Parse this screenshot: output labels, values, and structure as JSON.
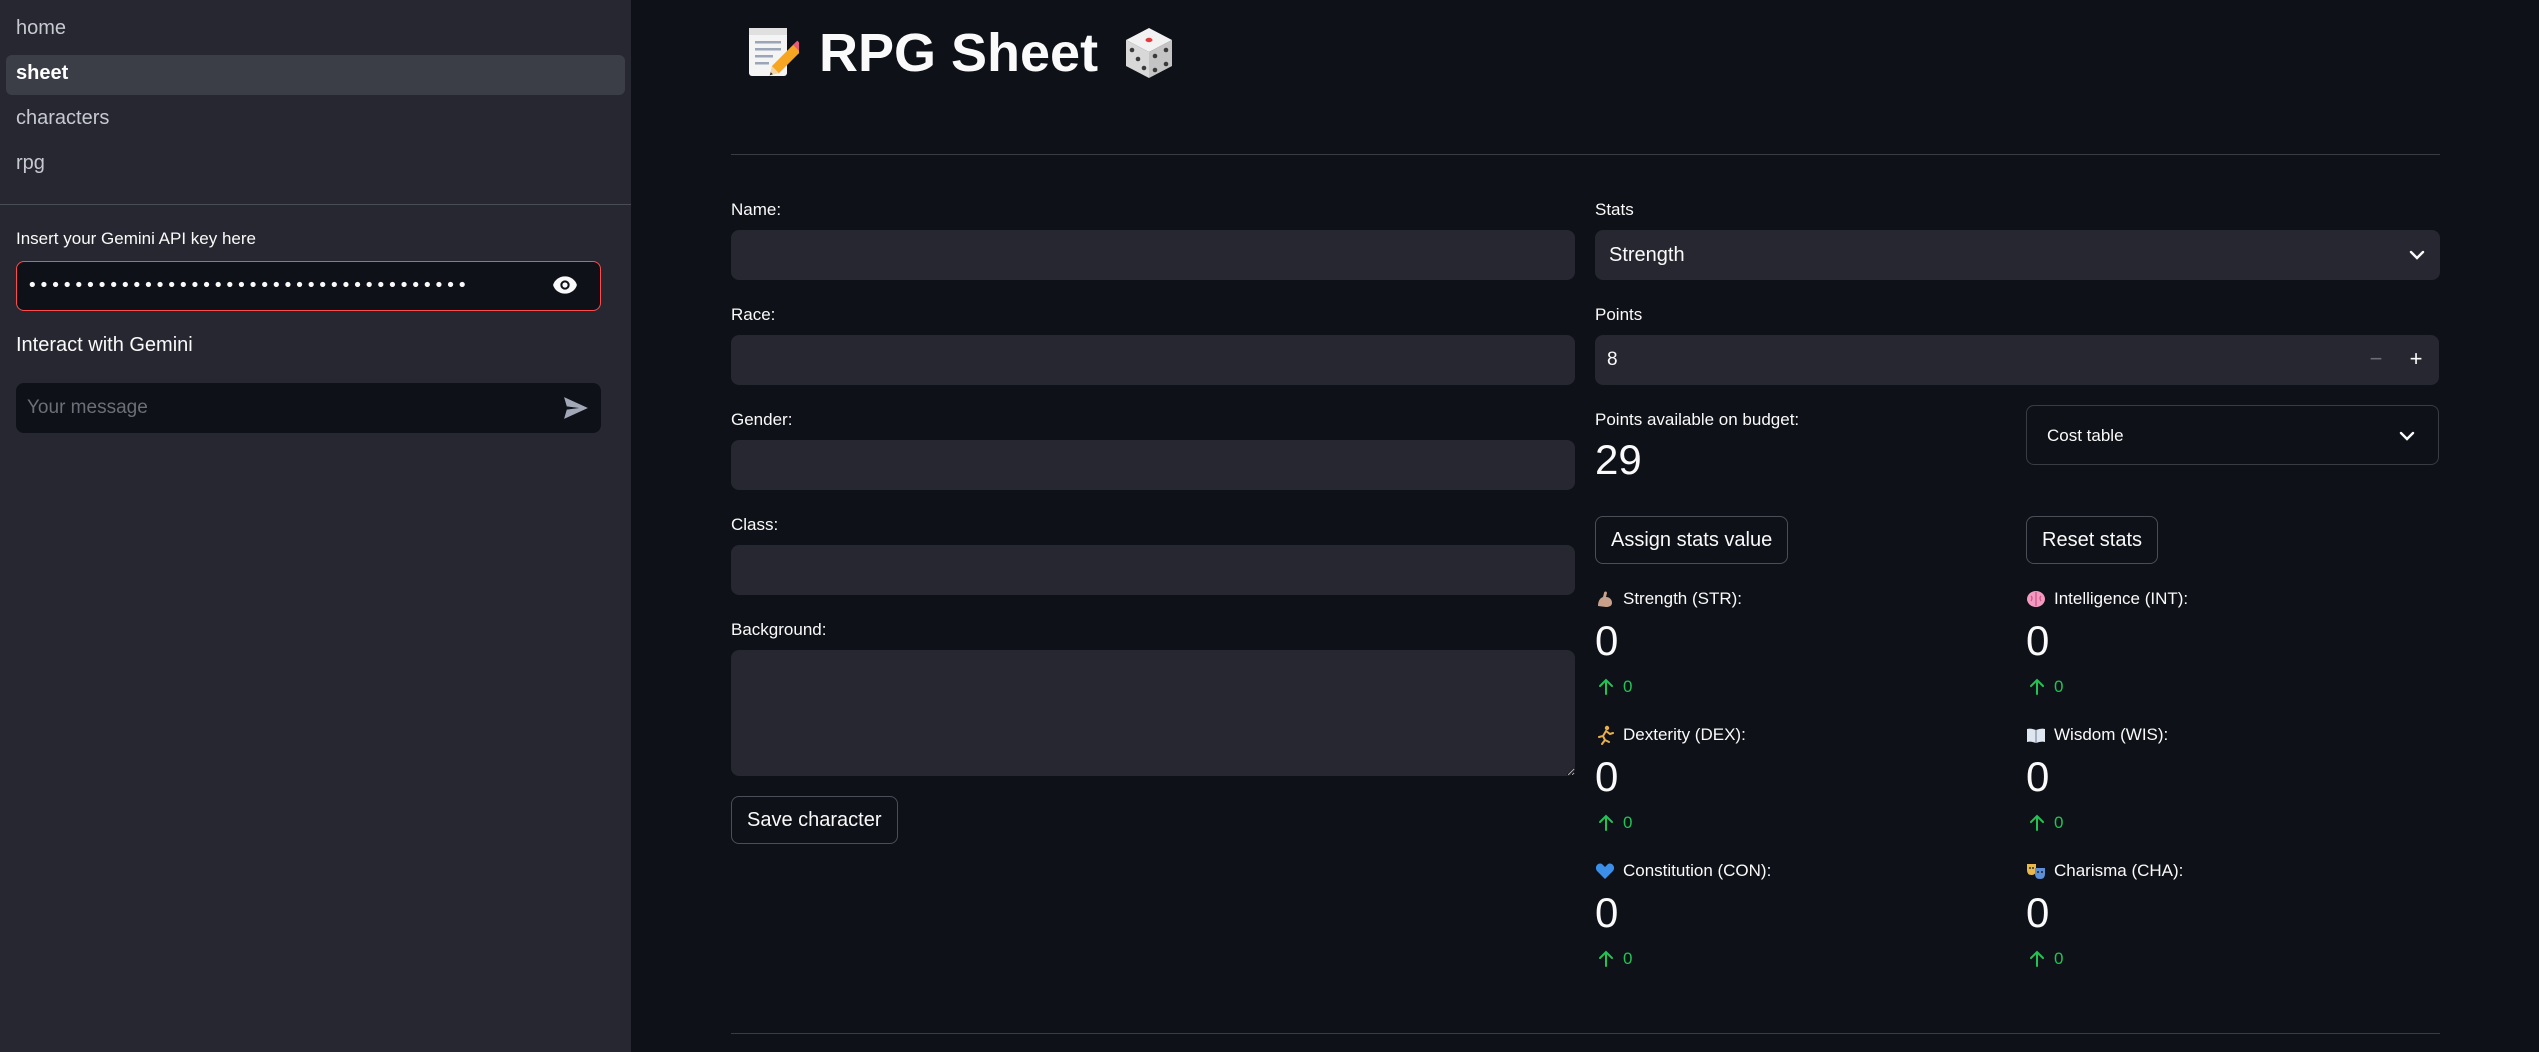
{
  "sidebar": {
    "nav": [
      {
        "label": "home",
        "active": false
      },
      {
        "label": "sheet",
        "active": true
      },
      {
        "label": "characters",
        "active": false
      },
      {
        "label": "rpg",
        "active": false
      }
    ],
    "api_key_label": "Insert your Gemini API key here",
    "api_key_value": "••••••••••••••••••••••••••••••••••••••",
    "eye_icon": "eye-icon",
    "gemini_title": "Interact with Gemini",
    "chat_placeholder": "Your message",
    "send_icon": "send-icon"
  },
  "main": {
    "title": "RPG Sheet",
    "title_icons": [
      "memo-icon",
      "dice-icon"
    ],
    "form": {
      "name_label": "Name:",
      "race_label": "Race:",
      "gender_label": "Gender:",
      "class_label": "Class:",
      "background_label": "Background:",
      "save_button": "Save character"
    },
    "stats_label": "Stats",
    "stats_selected": "Strength",
    "points_label": "Points",
    "points_value": "8",
    "budget_label": "Points available on budget:",
    "budget_value": "29",
    "cost_table_label": "Cost table",
    "assign_button": "Assign stats value",
    "reset_button": "Reset stats",
    "stats": [
      {
        "icon": "flexed-biceps-icon",
        "label": "Strength (STR):",
        "value": "0",
        "delta": "0"
      },
      {
        "icon": "brain-icon",
        "label": "Intelligence (INT):",
        "value": "0",
        "delta": "0"
      },
      {
        "icon": "running-person-icon",
        "label": "Dexterity (DEX):",
        "value": "0",
        "delta": "0"
      },
      {
        "icon": "open-book-icon",
        "label": "Wisdom (WIS):",
        "value": "0",
        "delta": "0"
      },
      {
        "icon": "blue-heart-icon",
        "label": "Constitution (CON):",
        "value": "0",
        "delta": "0"
      },
      {
        "icon": "performing-arts-icon",
        "label": "Charisma (CHA):",
        "value": "0",
        "delta": "0"
      }
    ]
  },
  "colors": {
    "app_bg": "#0e1117",
    "sidebar_bg": "#262730",
    "input_bg": "#262730",
    "error_border": "#ff4b4b",
    "delta_green": "#21c354",
    "text": "#fafafa"
  }
}
